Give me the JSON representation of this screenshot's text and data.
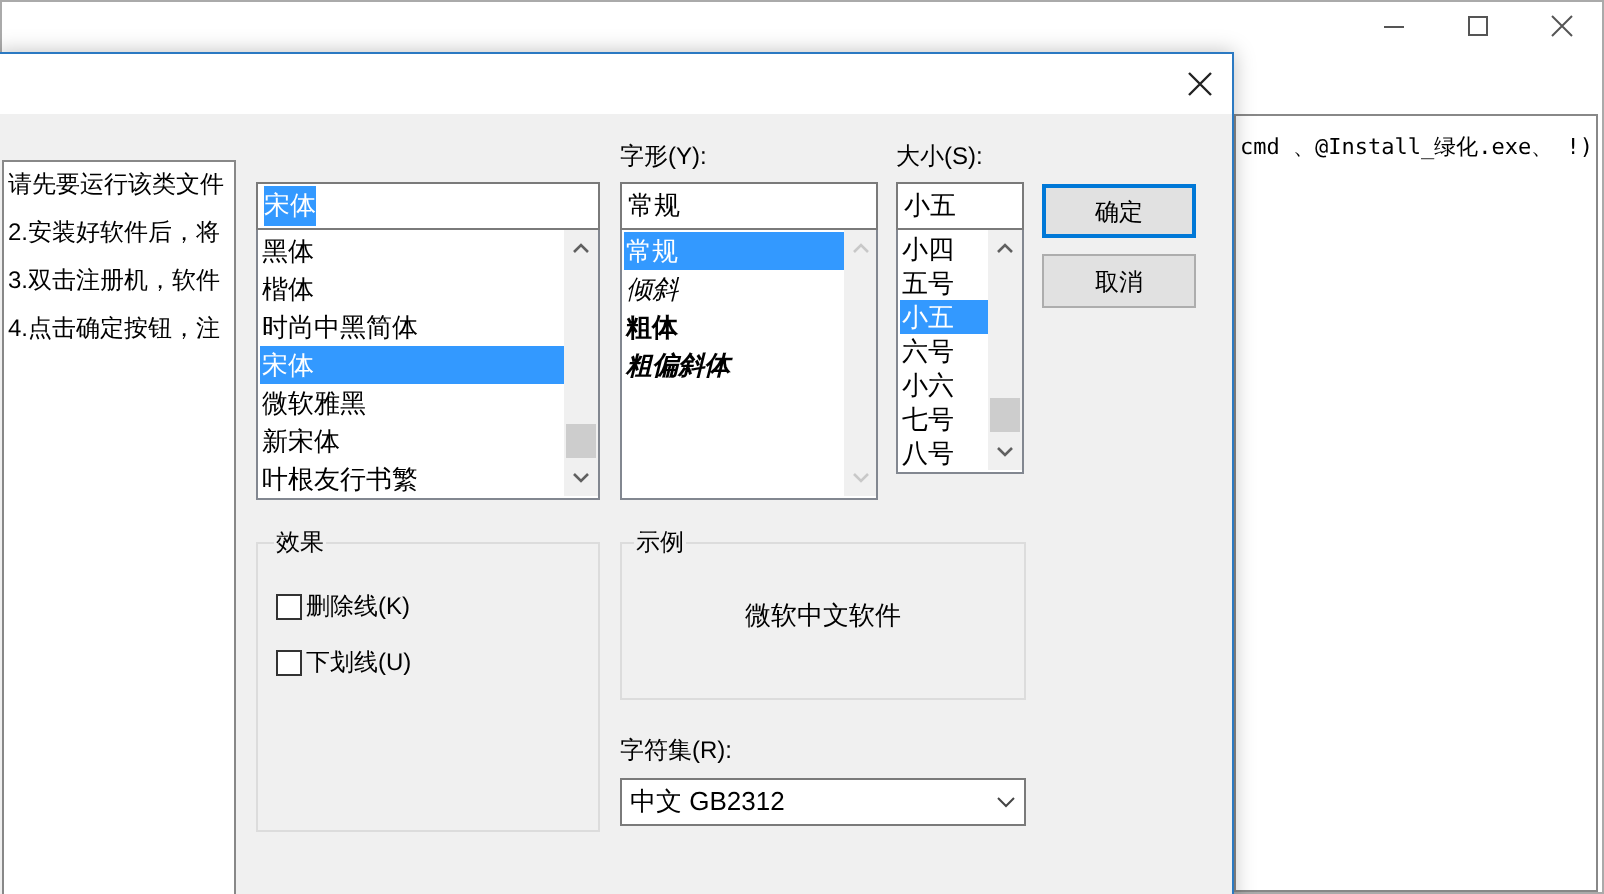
{
  "background_window": {
    "left_lines": [
      "请先要运行该类文件",
      "2.安装好软件后，将",
      "3.双击注册机，软件",
      "4.点击确定按钮，注"
    ],
    "right_line": "cmd 、@Install_绿化.exe、 !)"
  },
  "dialog": {
    "font": {
      "value": "宋体",
      "value_highlighted": true,
      "items": [
        {
          "label": "黑体",
          "selected": false
        },
        {
          "label": "楷体",
          "selected": false
        },
        {
          "label": "时尚中黑简体",
          "selected": false
        },
        {
          "label": "宋体",
          "selected": true
        },
        {
          "label": "微软雅黑",
          "selected": false
        },
        {
          "label": "新宋体",
          "selected": false
        },
        {
          "label": "叶根友行书繁",
          "selected": false
        }
      ]
    },
    "style": {
      "label": "字形(Y):",
      "value": "常规",
      "items": [
        {
          "label": "常规",
          "kind": "regular",
          "selected": true
        },
        {
          "label": "倾斜",
          "kind": "italic",
          "selected": false
        },
        {
          "label": "粗体",
          "kind": "bold",
          "selected": false
        },
        {
          "label": "粗偏斜体",
          "kind": "bold_italic",
          "selected": false
        }
      ]
    },
    "size": {
      "label": "大小(S):",
      "value": "小五",
      "items": [
        {
          "label": "小四",
          "selected": false
        },
        {
          "label": "五号",
          "selected": false
        },
        {
          "label": "小五",
          "selected": true
        },
        {
          "label": "六号",
          "selected": false
        },
        {
          "label": "小六",
          "selected": false
        },
        {
          "label": "七号",
          "selected": false
        },
        {
          "label": "八号",
          "selected": false
        }
      ]
    },
    "buttons": [
      {
        "label": "确定",
        "default": true
      },
      {
        "label": "取消",
        "default": false
      }
    ],
    "effects": {
      "title": "效果",
      "options": [
        {
          "label": "删除线(K)",
          "checked": false
        },
        {
          "label": "下划线(U)",
          "checked": false
        }
      ]
    },
    "sample": {
      "title": "示例",
      "text": "微软中文软件"
    },
    "charset": {
      "label": "字符集(R):",
      "value": "中文 GB2312"
    }
  }
}
